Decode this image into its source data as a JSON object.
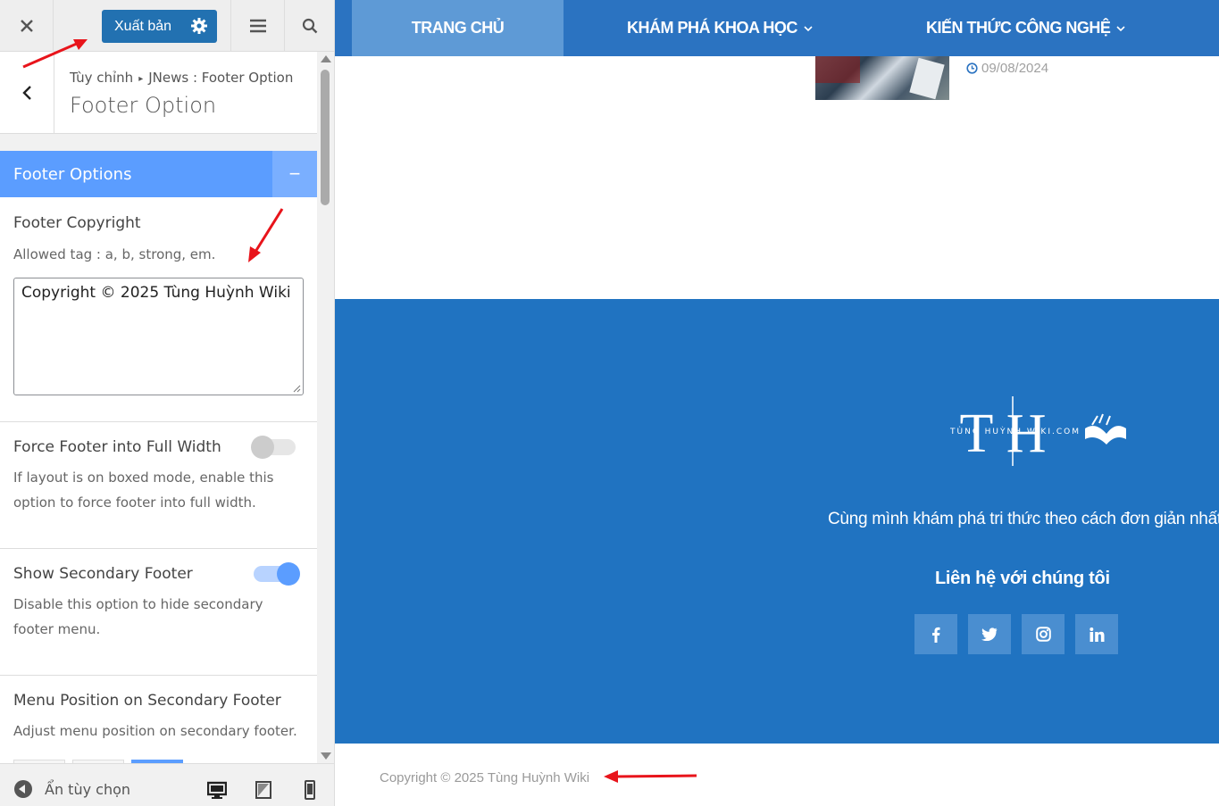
{
  "sidebar": {
    "publish_label": "Xuất bản",
    "breadcrumb": {
      "root": "Tùy chỉnh",
      "parent": "JNews : Footer Option"
    },
    "panel_title": "Footer Option",
    "section_title": "Footer Options",
    "section_toggle": "−",
    "controls": {
      "copyright": {
        "title": "Footer Copyright",
        "desc": "Allowed tag : a, b, strong, em.",
        "value": "Copyright © 2025 Tùng Huỳnh Wiki"
      },
      "full_width": {
        "title": "Force Footer into Full Width",
        "desc": "If layout is on boxed mode, enable this option to force footer into full width.",
        "enabled": false
      },
      "secondary": {
        "title": "Show Secondary Footer",
        "desc": "Disable this option to hide secondary footer menu.",
        "enabled": true
      },
      "menu_position": {
        "title": "Menu Position on Secondary Footer",
        "desc": "Adjust menu position on secondary footer."
      }
    },
    "bottom": {
      "hide_label": "Ẩn tùy chọn"
    }
  },
  "preview": {
    "nav": [
      {
        "label": "TRANG CHỦ",
        "active": true,
        "has_dropdown": false
      },
      {
        "label": "KHÁM PHÁ KHOA HỌC",
        "active": false,
        "has_dropdown": true
      },
      {
        "label": "KIẾN THỨC CÔNG NGHỆ",
        "active": false,
        "has_dropdown": true
      }
    ],
    "post_date": "09/08/2024",
    "logo_letters": "T H",
    "logo_subtext": "TÙNG HUỲNH WIKI.COM",
    "tagline": "Cùng mình khám phá tri thức theo cách đơn giản nhất!",
    "contact_title": "Liên hệ với chúng tôi",
    "socials": [
      {
        "name": "facebook",
        "glyph": "f"
      },
      {
        "name": "twitter",
        "glyph": "t"
      },
      {
        "name": "instagram",
        "glyph": "ig"
      },
      {
        "name": "linkedin",
        "glyph": "in"
      }
    ],
    "copyright": "Copyright © 2025 Tùng Huỳnh Wiki"
  },
  "colors": {
    "nav_bg": "#2b73c1",
    "footer_bg": "#2073c1",
    "section_accent": "#5b9dff",
    "publish_btn": "#2271b1",
    "annotation_arrow": "#e8141b"
  }
}
